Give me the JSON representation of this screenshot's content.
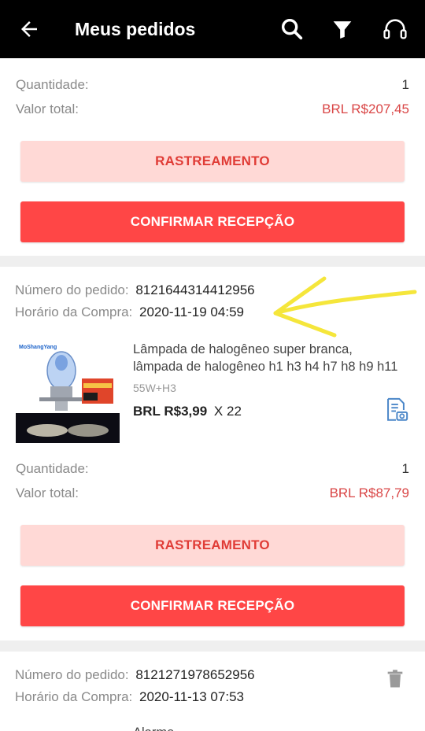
{
  "header": {
    "title": "Meus pedidos",
    "back_icon": "arrow-left-icon",
    "search_icon": "search-icon",
    "filter_icon": "filter-icon",
    "support_icon": "headset-icon"
  },
  "order1": {
    "quantity_label": "Quantidade:",
    "quantity": "1",
    "total_label": "Valor total:",
    "total": "BRL R$207,45",
    "track_label": "RASTREAMENTO",
    "confirm_label": "CONFIRMAR RECEPÇÃO"
  },
  "order2": {
    "order_number_label": "Número do pedido:",
    "order_number": "8121644314412956",
    "purchase_time_label": "Horário da Compra:",
    "purchase_time": "2020-11-19 04:59",
    "product": {
      "name_line1": "Lâmpada de halogêneo super branca,",
      "name_line2": "lâmpada de halogêneo h1 h3 h4 h7 h8 h9 h11",
      "variant": "55W+H3",
      "price": "BRL R$3,99",
      "qty": "X 22",
      "brand_text": "MoShangYang"
    },
    "quantity_label": "Quantidade:",
    "quantity": "1",
    "total_label": "Valor total:",
    "total": "BRL R$87,79",
    "track_label": "RASTREAMENTO",
    "confirm_label": "CONFIRMAR RECEPÇÃO"
  },
  "order3": {
    "order_number_label": "Número do pedido:",
    "order_number": "8121271978652956",
    "purchase_time_label": "Horário da Compra:",
    "purchase_time": "2020-11-13 07:53",
    "product_name_partial": "Alarme..."
  },
  "colors": {
    "accent": "#ff4646",
    "accent_light": "#ffd9d6",
    "price_red": "#d94545",
    "annotation": "#f5e63b"
  }
}
